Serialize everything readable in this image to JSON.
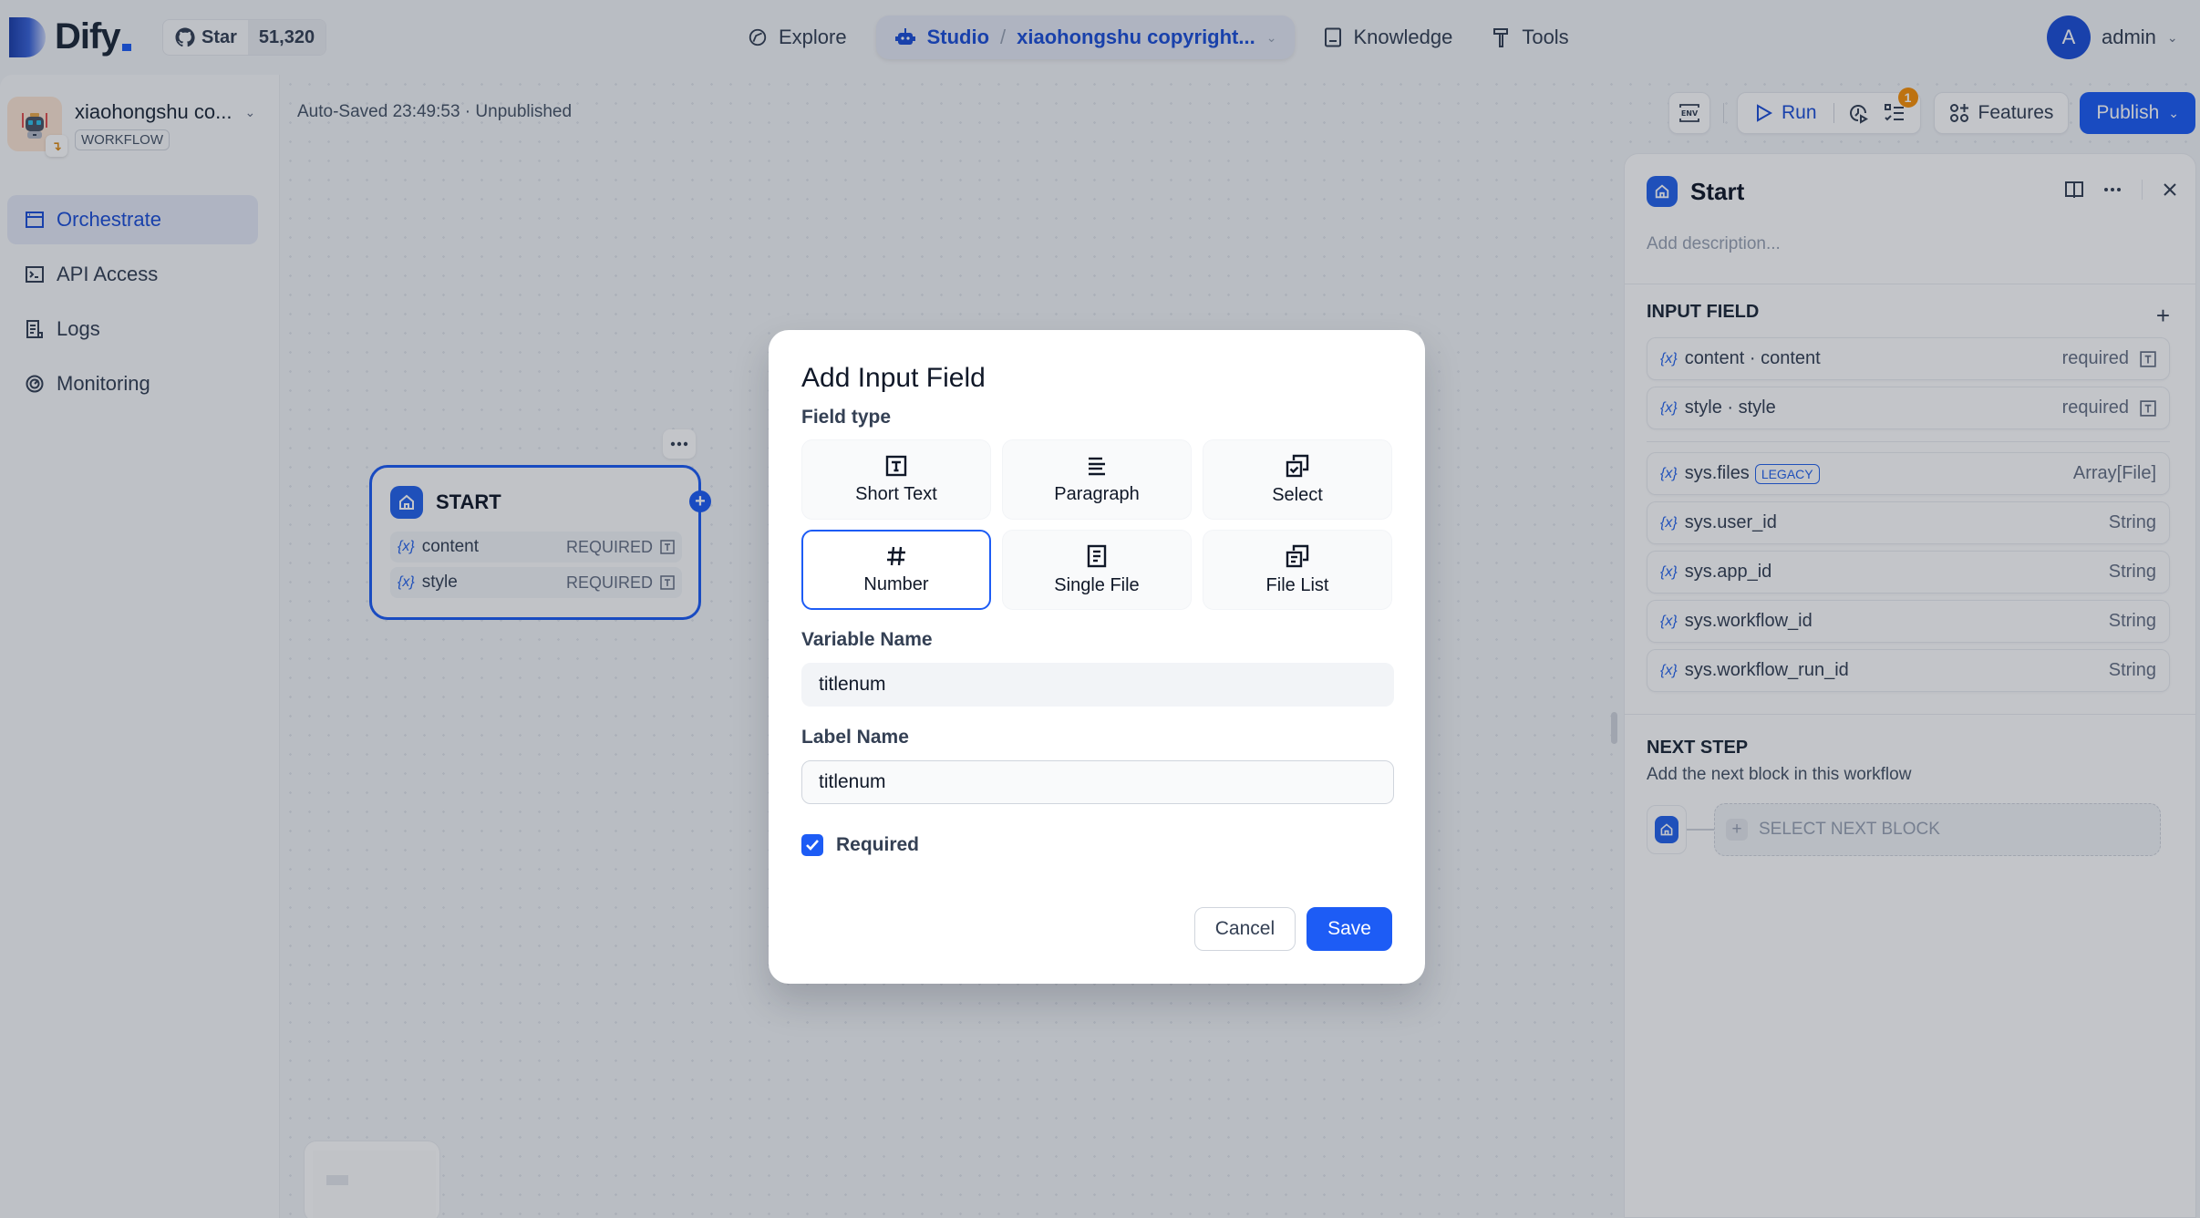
{
  "brand": {
    "name": "Dify",
    "github_star_label": "Star",
    "github_star_count": "51,320"
  },
  "nav": {
    "explore": "Explore",
    "studio": "Studio",
    "app_crumb": "xiaohongshu copyright...",
    "knowledge": "Knowledge",
    "tools": "Tools"
  },
  "user": {
    "initial": "A",
    "name": "admin"
  },
  "app": {
    "name": "xiaohongshu co...",
    "type": "WORKFLOW"
  },
  "sidebar": {
    "items": [
      {
        "label": "Orchestrate",
        "icon": "window-icon",
        "active": true
      },
      {
        "label": "API Access",
        "icon": "terminal-icon",
        "active": false
      },
      {
        "label": "Logs",
        "icon": "document-icon",
        "active": false
      },
      {
        "label": "Monitoring",
        "icon": "gauge-icon",
        "active": false
      }
    ]
  },
  "canvas": {
    "autosave": "Auto-Saved 23:49:53 · Unpublished",
    "toolbar": {
      "env": "ENV",
      "run": "Run",
      "checklist_count": "1",
      "features": "Features",
      "publish": "Publish"
    },
    "start_node": {
      "title": "START",
      "variables": [
        {
          "name": "content",
          "badge": "REQUIRED"
        },
        {
          "name": "style",
          "badge": "REQUIRED"
        }
      ]
    }
  },
  "panel": {
    "title": "Start",
    "description_placeholder": "Add description...",
    "input_field_title": "INPUT FIELD",
    "input_fields": [
      {
        "name": "content · content",
        "status": "required"
      },
      {
        "name": "style · style",
        "status": "required"
      }
    ],
    "system_vars": [
      {
        "name": "sys.files",
        "tag": "LEGACY",
        "type": "Array[File]"
      },
      {
        "name": "sys.user_id",
        "type": "String"
      },
      {
        "name": "sys.app_id",
        "type": "String"
      },
      {
        "name": "sys.workflow_id",
        "type": "String"
      },
      {
        "name": "sys.workflow_run_id",
        "type": "String"
      }
    ],
    "next_step_title": "NEXT STEP",
    "next_step_desc": "Add the next block in this workflow",
    "select_next_block": "SELECT NEXT BLOCK"
  },
  "modal": {
    "title": "Add Input Field",
    "field_type_label": "Field type",
    "field_types": [
      {
        "label": "Short Text",
        "selected": false
      },
      {
        "label": "Paragraph",
        "selected": false
      },
      {
        "label": "Select",
        "selected": false
      },
      {
        "label": "Number",
        "selected": true
      },
      {
        "label": "Single File",
        "selected": false
      },
      {
        "label": "File List",
        "selected": false
      }
    ],
    "variable_name_label": "Variable Name",
    "variable_name_value": "titlenum",
    "label_name_label": "Label Name",
    "label_name_value": "titlenum",
    "required_label": "Required",
    "required_checked": true,
    "cancel": "Cancel",
    "save": "Save"
  },
  "colors": {
    "accent": "#1d5cf5",
    "warning": "#f79009"
  }
}
